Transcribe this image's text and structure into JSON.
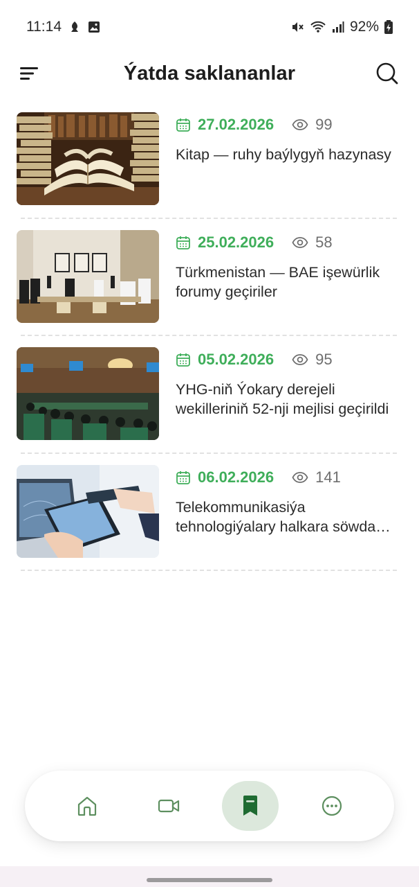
{
  "status_bar": {
    "time": "11:14",
    "battery": "92%"
  },
  "header": {
    "title": "Ýatda saklananlar"
  },
  "news": [
    {
      "date": "27.02.2026",
      "views": "99",
      "title": "Kitap — ruhy baýlygyň hazynasy"
    },
    {
      "date": "25.02.2026",
      "views": "58",
      "title": "Türkmenistan — BAE işewürlik forumy geçiriler"
    },
    {
      "date": "05.02.2026",
      "views": "95",
      "title": "YHG-niň Ýokary derejeli wekilleriniň 52-nji mejlisi geçirildi"
    },
    {
      "date": "06.02.2026",
      "views": "141",
      "title": "Telekommunikasiýa tehnologiýalary halkara söwda sergisi"
    }
  ],
  "nav": {
    "items": [
      "home-icon",
      "video-icon",
      "bookmark-icon",
      "more-icon"
    ],
    "active_index": 2
  },
  "colors": {
    "accent": "#3fae5a",
    "nav_icon": "#5d8f5f",
    "nav_active_bg": "#dce8dc",
    "nav_active_icon": "#1f6b32"
  }
}
